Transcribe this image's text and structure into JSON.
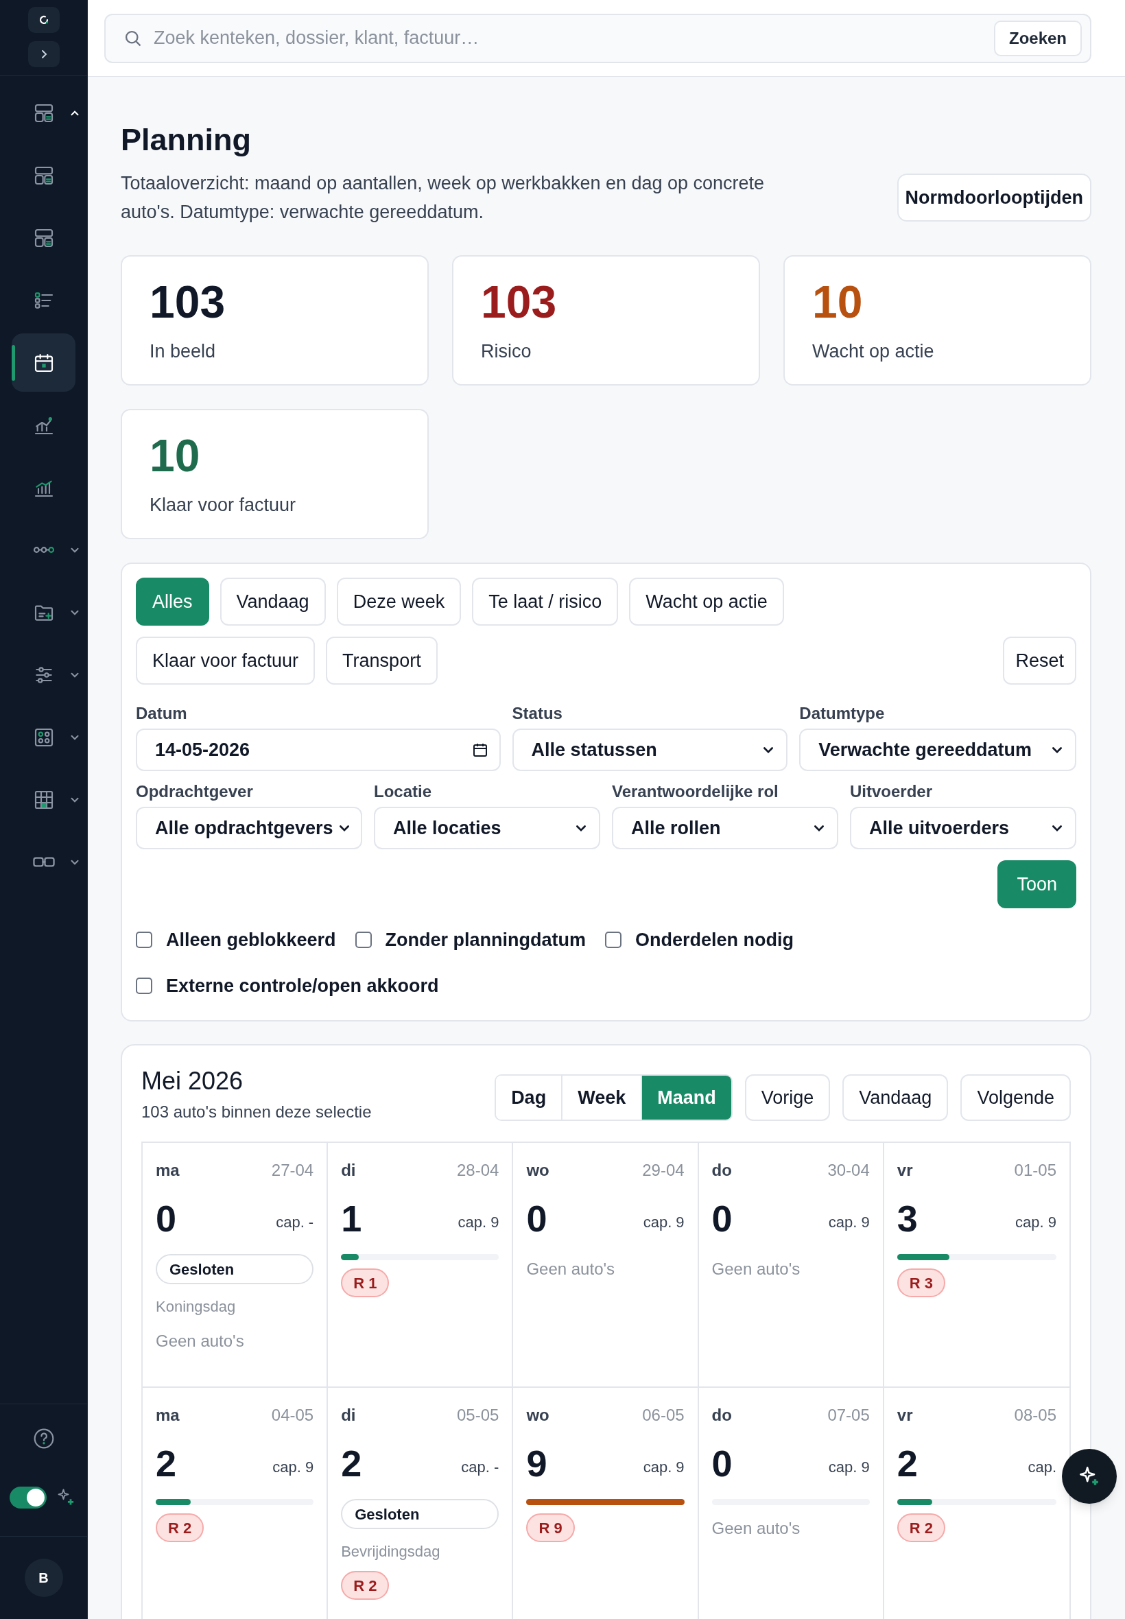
{
  "sidebar": {
    "top_buttons": [
      {
        "kind": "logo"
      },
      {
        "kind": "expand"
      }
    ],
    "items": [
      {
        "kind": "group",
        "expanded": true,
        "selected": false
      },
      {
        "kind": "link",
        "selected": false
      },
      {
        "kind": "link",
        "selected": false
      },
      {
        "kind": "link",
        "selected": false
      },
      {
        "kind": "link",
        "selected": true
      },
      {
        "kind": "link",
        "selected": false
      },
      {
        "kind": "link",
        "selected": false
      },
      {
        "kind": "group",
        "expanded": false,
        "selected": false
      },
      {
        "kind": "group",
        "expanded": false,
        "selected": false
      },
      {
        "kind": "group",
        "expanded": false,
        "selected": false
      },
      {
        "kind": "group",
        "expanded": false,
        "selected": false
      },
      {
        "kind": "group",
        "expanded": false,
        "selected": false
      },
      {
        "kind": "group",
        "expanded": false,
        "selected": false
      }
    ],
    "toggle": {
      "on": true
    },
    "avatar": "B"
  },
  "search": {
    "placeholder": "Zoek kenteken, dossier, klant, factuur…",
    "button": "Zoeken"
  },
  "page": {
    "title": "Planning",
    "description": "Totaaloverzicht: maand op aantallen, week op werkbakken en dag op concrete auto's. Datumtype: verwachte gereeddatum.",
    "action": "Normdoorlooptijden"
  },
  "stats": [
    {
      "value": "103",
      "label": "In beeld",
      "color": "#111827"
    },
    {
      "value": "103",
      "label": "Risico",
      "color": "#9b1c1c"
    },
    {
      "value": "10",
      "label": "Wacht op actie",
      "color": "#b8500f"
    },
    {
      "value": "10",
      "label": "Klaar voor factuur",
      "color": "#1f6b4e"
    }
  ],
  "filters": {
    "chips": [
      {
        "label": "Alles",
        "selected": true
      },
      {
        "label": "Vandaag",
        "selected": false
      },
      {
        "label": "Deze week",
        "selected": false
      },
      {
        "label": "Te laat / risico",
        "selected": false
      },
      {
        "label": "Wacht op actie",
        "selected": false
      },
      {
        "label": "Klaar voor factuur",
        "selected": false
      },
      {
        "label": "Transport",
        "selected": false
      }
    ],
    "reset": "Reset",
    "fields": [
      {
        "label": "Datum",
        "value": "14-05-2026",
        "kind": "date"
      },
      {
        "label": "Status",
        "value": "Alle statussen",
        "kind": "select"
      },
      {
        "label": "Datumtype",
        "value": "Verwachte gereeddatum",
        "kind": "select"
      }
    ],
    "fields_2": [
      {
        "label": "Opdrachtgever",
        "value": "Alle opdrachtgevers",
        "kind": "select"
      },
      {
        "label": "Locatie",
        "value": "Alle locaties",
        "kind": "select"
      },
      {
        "label": "Verantwoordelijke rol",
        "value": "Alle rollen",
        "kind": "select"
      },
      {
        "label": "Uitvoerder",
        "value": "Alle uitvoerders",
        "kind": "select"
      }
    ],
    "submit": "Toon",
    "checkboxes": [
      {
        "label": "Alleen geblokkeerd",
        "checked": false
      },
      {
        "label": "Zonder planningdatum",
        "checked": false
      },
      {
        "label": "Onderdelen nodig",
        "checked": false
      },
      {
        "label": "Externe controle/open akkoord",
        "checked": false
      }
    ]
  },
  "calendar": {
    "title": "Mei 2026",
    "subtitle": "103 auto's binnen deze selectie",
    "views": [
      {
        "label": "Dag",
        "selected": false
      },
      {
        "label": "Week",
        "selected": false
      },
      {
        "label": "Maand",
        "selected": true
      }
    ],
    "nav": [
      "Vorige",
      "Vandaag",
      "Volgende"
    ],
    "days": [
      {
        "day": "ma",
        "date": "27-04",
        "count": "0",
        "cap": "cap. -",
        "closed": "Gesloten",
        "note": "Koningsdag",
        "empty": "Geen auto's"
      },
      {
        "day": "di",
        "date": "28-04",
        "count": "1",
        "cap": "cap. 9",
        "bar": {
          "level": 0.11
        },
        "risk": "R 1"
      },
      {
        "day": "wo",
        "date": "29-04",
        "count": "0",
        "cap": "cap. 9",
        "empty": "Geen auto's"
      },
      {
        "day": "do",
        "date": "30-04",
        "count": "0",
        "cap": "cap. 9",
        "empty": "Geen auto's"
      },
      {
        "day": "vr",
        "date": "01-05",
        "count": "3",
        "cap": "cap. 9",
        "bar": {
          "level": 0.33
        },
        "risk": "R 3"
      },
      {
        "day": "ma",
        "date": "04-05",
        "count": "2",
        "cap": "cap. 9",
        "bar": {
          "level": 0.22
        },
        "risk": "R 2"
      },
      {
        "day": "di",
        "date": "05-05",
        "count": "2",
        "cap": "cap. -",
        "closed": "Gesloten",
        "note": "Bevrijdingsdag",
        "risk": "R 2"
      },
      {
        "day": "wo",
        "date": "06-05",
        "count": "9",
        "cap": "cap. 9",
        "bar": {
          "level": 1
        },
        "risk": "R 9"
      },
      {
        "day": "do",
        "date": "07-05",
        "count": "0",
        "cap": "cap. 9",
        "bar": {
          "level": 0
        },
        "empty": "Geen auto's"
      },
      {
        "day": "vr",
        "date": "08-05",
        "count": "2",
        "cap": "cap.",
        "bar": {
          "level": 0.22
        },
        "risk": "R 2"
      }
    ]
  }
}
